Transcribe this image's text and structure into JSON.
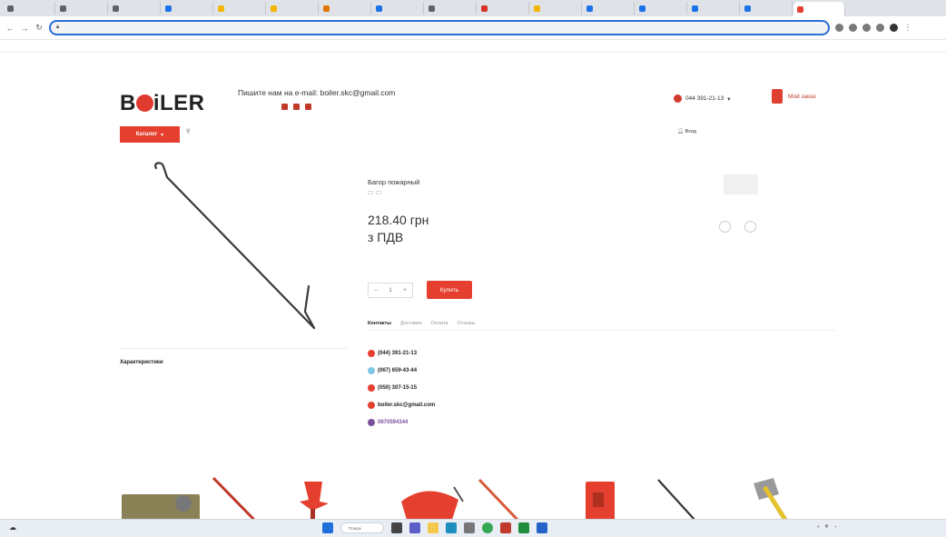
{
  "browser": {
    "tabs": [
      {
        "label": "",
        "color": "#5f6368"
      },
      {
        "label": "",
        "color": "#5f6368"
      },
      {
        "label": "",
        "color": "#5f6368"
      },
      {
        "label": "",
        "color": "#1a73e8"
      },
      {
        "label": "",
        "color": "#f4b400"
      },
      {
        "label": "",
        "color": "#f4b400"
      },
      {
        "label": "",
        "color": "#e37400"
      },
      {
        "label": "",
        "color": "#1a73e8"
      },
      {
        "label": "",
        "color": "#5f6368"
      },
      {
        "label": "",
        "color": "#d93025"
      },
      {
        "label": "",
        "color": "#f4b400"
      },
      {
        "label": "",
        "color": "#1a73e8"
      },
      {
        "label": "",
        "color": "#1a73e8"
      },
      {
        "label": "",
        "color": "#1a73e8"
      },
      {
        "label": "",
        "color": "#1a73e8"
      },
      {
        "label": "",
        "color": "#e5402f",
        "active": true
      }
    ],
    "url": "",
    "bookmark_left": "",
    "bookmark_right": ""
  },
  "site": {
    "top_notice": "",
    "logo_text_b": "B",
    "logo_text_rest": "iLER",
    "logo_sup": "",
    "email_line": "Пишите нам на e-mail: boiler.skc@gmail.com",
    "menu_links": [
      "",
      "",
      "",
      "",
      "",
      "",
      "",
      ""
    ],
    "phone": "044 391-21-13",
    "cart_label": "Мой заказ",
    "catalog_label": "Каталог",
    "search_placeholder": "",
    "header_right": {
      "lang": "",
      "compare": "",
      "favorites": "",
      "login": "Вход"
    }
  },
  "product": {
    "breadcrumb": "",
    "title": "Багор пожарный",
    "subtags": [
      "",
      ""
    ],
    "price": "218.40 грн",
    "vat": "з ПДВ",
    "sku_label": "",
    "sku_value": "",
    "compare_label": "",
    "favorite_label": "",
    "qty_value": "1",
    "buy_label": "Купить",
    "tabs": [
      "Контакты",
      "Доставка",
      "Оплата",
      "Отзывы"
    ],
    "contacts": [
      {
        "text": "(044) 391-21-13",
        "icon": "kyivstar-icon",
        "color": "#e5402f"
      },
      {
        "text": "(067) 659-43-44",
        "icon": "star-icon",
        "color": "#7ec8e3"
      },
      {
        "text": "(050) 307-15-15",
        "icon": "vodafone-icon",
        "color": "#e5402f"
      },
      {
        "text": "boiler.skc@gmail.com",
        "icon": "mail-icon",
        "color": "#e5402f"
      },
      {
        "text": "0670594344",
        "extra": "",
        "icon": "viber-icon",
        "color": "#7b519d"
      }
    ],
    "characteristics_title": "Характеристики",
    "characteristics": [
      {
        "name": "",
        "value": ""
      },
      {
        "name": "",
        "value": ""
      }
    ],
    "see_also_title": ""
  },
  "taskbar": {
    "weather": "",
    "search_label": "Пошук",
    "tray_time": "",
    "tray_date": ""
  },
  "colors": {
    "accent": "#e5402f",
    "link": "#c0392b"
  }
}
